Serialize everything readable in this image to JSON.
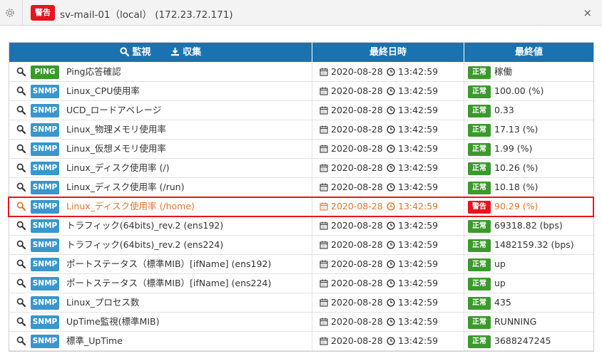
{
  "window": {
    "badge": "警告",
    "title": "sv-mail-01（local） (172.23.72.171)",
    "close_symbol": "×"
  },
  "table": {
    "headers": {
      "monitor": "監視",
      "collect": "収集",
      "last_datetime": "最終日時",
      "last_value": "最終値"
    },
    "rows": [
      {
        "type": "PING",
        "type_color": "#3a9a2b",
        "name": "Ping応答確認",
        "date": "2020-08-28",
        "time": "13:42:59",
        "status": "正常",
        "status_color": "#3a9a2b",
        "value": "稼働"
      },
      {
        "type": "SNMP",
        "type_color": "#3a96cc",
        "name": "Linux_CPU使用率",
        "date": "2020-08-28",
        "time": "13:42:59",
        "status": "正常",
        "status_color": "#3a9a2b",
        "value": "100.00 (%)"
      },
      {
        "type": "SNMP",
        "type_color": "#3a96cc",
        "name": "UCD_ロードアベレージ",
        "date": "2020-08-28",
        "time": "13:42:59",
        "status": "正常",
        "status_color": "#3a9a2b",
        "value": "0.33"
      },
      {
        "type": "SNMP",
        "type_color": "#3a96cc",
        "name": "Linux_物理メモリ使用率",
        "date": "2020-08-28",
        "time": "13:42:59",
        "status": "正常",
        "status_color": "#3a9a2b",
        "value": "17.13 (%)"
      },
      {
        "type": "SNMP",
        "type_color": "#3a96cc",
        "name": "Linux_仮想メモリ使用率",
        "date": "2020-08-28",
        "time": "13:42:59",
        "status": "正常",
        "status_color": "#3a9a2b",
        "value": "1.99 (%)"
      },
      {
        "type": "SNMP",
        "type_color": "#3a96cc",
        "name": "Linux_ディスク使用率 (/)",
        "date": "2020-08-28",
        "time": "13:42:59",
        "status": "正常",
        "status_color": "#3a9a2b",
        "value": "10.26 (%)"
      },
      {
        "type": "SNMP",
        "type_color": "#3a96cc",
        "name": "Linux_ディスク使用率 (/run)",
        "date": "2020-08-28",
        "time": "13:42:59",
        "status": "正常",
        "status_color": "#3a9a2b",
        "value": "10.18 (%)"
      },
      {
        "type": "SNMP",
        "type_color": "#3a96cc",
        "name": "Linux_ディスク使用率 (/home)",
        "date": "2020-08-28",
        "time": "13:42:59",
        "status": "警告",
        "status_color": "#e8141c",
        "value": "90.29 (%)",
        "alert": true
      },
      {
        "type": "SNMP",
        "type_color": "#3a96cc",
        "name": "トラフィック(64bits)_rev.2 (ens192)",
        "date": "2020-08-28",
        "time": "13:42:59",
        "status": "正常",
        "status_color": "#3a9a2b",
        "value": "69318.82 (bps)"
      },
      {
        "type": "SNMP",
        "type_color": "#3a96cc",
        "name": "トラフィック(64bits)_rev.2 (ens224)",
        "date": "2020-08-28",
        "time": "13:42:59",
        "status": "正常",
        "status_color": "#3a9a2b",
        "value": "1482159.32 (bps)"
      },
      {
        "type": "SNMP",
        "type_color": "#3a96cc",
        "name": "ポートステータス（標準MIB）[ifName] (ens192)",
        "date": "2020-08-28",
        "time": "13:42:59",
        "status": "正常",
        "status_color": "#3a9a2b",
        "value": "up"
      },
      {
        "type": "SNMP",
        "type_color": "#3a96cc",
        "name": "ポートステータス（標準MIB）[ifName] (ens224)",
        "date": "2020-08-28",
        "time": "13:42:59",
        "status": "正常",
        "status_color": "#3a9a2b",
        "value": "up"
      },
      {
        "type": "SNMP",
        "type_color": "#3a96cc",
        "name": "Linux_プロセス数",
        "date": "2020-08-28",
        "time": "13:42:59",
        "status": "正常",
        "status_color": "#3a9a2b",
        "value": "435"
      },
      {
        "type": "SNMP",
        "type_color": "#3a96cc",
        "name": "UpTime監視(標準MIB)",
        "date": "2020-08-28",
        "time": "13:42:59",
        "status": "正常",
        "status_color": "#3a9a2b",
        "value": "RUNNING"
      },
      {
        "type": "SNMP",
        "type_color": "#3a96cc",
        "name": "標準_UpTime",
        "date": "2020-08-28",
        "time": "13:42:59",
        "status": "正常",
        "status_color": "#3a9a2b",
        "value": "3688247245"
      }
    ]
  },
  "icons": {
    "settings": "gear-icon",
    "search": "search-icon",
    "download": "download-icon",
    "calendar": "calendar-icon",
    "clock": "clock-icon",
    "close": "close-icon"
  }
}
